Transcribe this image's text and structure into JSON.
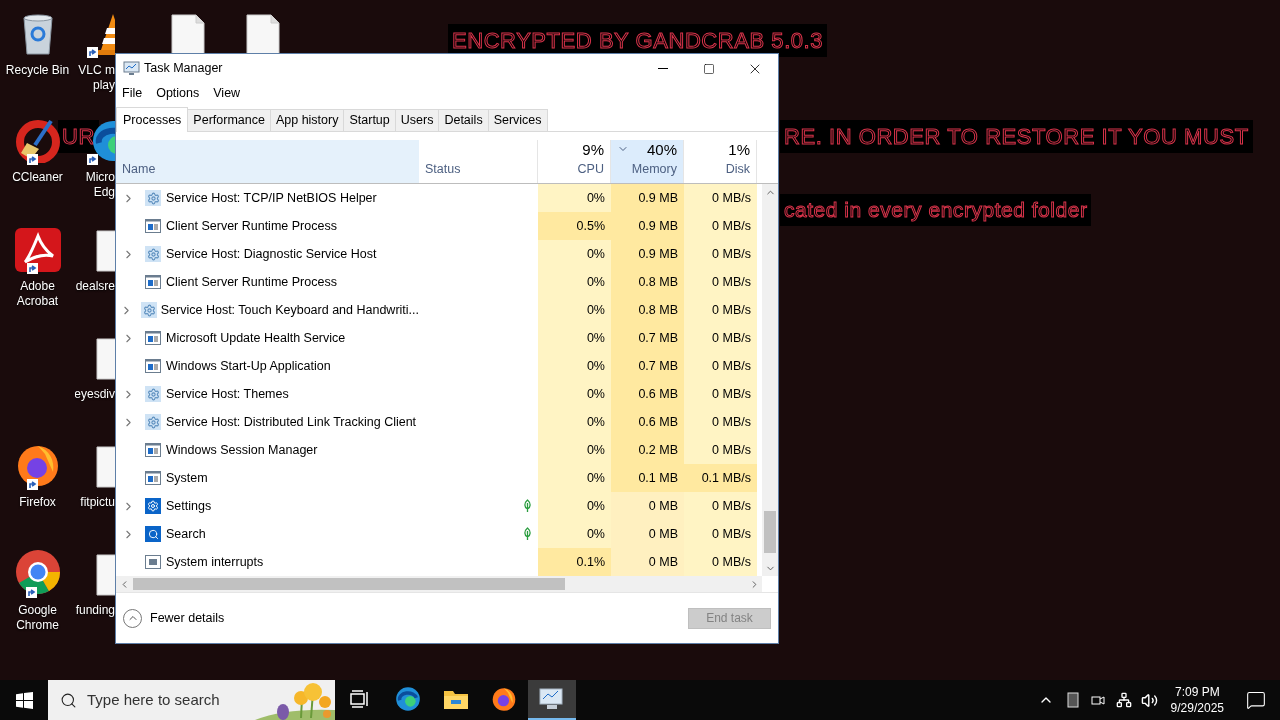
{
  "wallpaper_text": [
    {
      "text": "ENCRYPTED BY GANDCRAB 5.0.3"
    },
    {
      "text": "UR"
    },
    {
      "text": "RE. IN ORDER TO RESTORE IT YOU MUST"
    },
    {
      "text": "cated in every encrypted folder"
    }
  ],
  "desktop_icons": [
    {
      "kind": "recycle_bin",
      "label_lines": [
        "Recycle Bin"
      ],
      "shortcut": false
    },
    {
      "kind": "vlc",
      "label_lines": [
        "VLC m",
        "play"
      ],
      "shortcut": true
    },
    {
      "kind": "file",
      "shortcut": false
    },
    {
      "kind": "file",
      "shortcut": false
    },
    {
      "kind": "ccleaner",
      "label_lines": [
        "CCleaner"
      ],
      "shortcut": true
    },
    {
      "kind": "edge",
      "label_lines": [
        "Micro",
        "Edg"
      ],
      "shortcut": true
    },
    {
      "kind": "acrobat",
      "label_lines": [
        "Adobe",
        "Acrobat"
      ],
      "shortcut": true
    },
    {
      "kind": "file",
      "label_lines": [
        "dealsre"
      ],
      "shortcut": false
    },
    {
      "kind": "file",
      "label_lines": [
        "eyesdiv"
      ],
      "shortcut": false
    },
    {
      "kind": "firefox",
      "label_lines": [
        "Firefox"
      ],
      "shortcut": true
    },
    {
      "kind": "file",
      "label_lines": [
        "fitpictu"
      ],
      "shortcut": false
    },
    {
      "kind": "chrome",
      "label_lines": [
        "Google",
        "Chrome"
      ],
      "shortcut": true
    },
    {
      "kind": "file",
      "label_lines": [
        "funding"
      ],
      "shortcut": false
    }
  ],
  "window": {
    "title": "Task Manager",
    "menu": [
      "File",
      "Options",
      "View"
    ],
    "tabs": [
      {
        "label": "Processes",
        "selected": true
      },
      {
        "label": "Performance",
        "selected": false
      },
      {
        "label": "App history",
        "selected": false
      },
      {
        "label": "Startup",
        "selected": false
      },
      {
        "label": "Users",
        "selected": false
      },
      {
        "label": "Details",
        "selected": false
      },
      {
        "label": "Services",
        "selected": false
      }
    ],
    "columns": [
      {
        "kind": "name",
        "label": "Name",
        "highlighted": true
      },
      {
        "kind": "status",
        "label": "Status",
        "highlighted": false
      },
      {
        "kind": "metric",
        "percent": "9%",
        "label": "CPU",
        "highlighted": false,
        "sorted": false
      },
      {
        "kind": "metric",
        "percent": "40%",
        "label": "Memory",
        "highlighted": true,
        "sorted": true
      },
      {
        "kind": "metric",
        "percent": "1%",
        "label": "Disk",
        "highlighted": false,
        "sorted": false
      }
    ],
    "rows": [
      {
        "name": "Service Host: TCP/IP NetBIOS Helper",
        "kind": "gear",
        "expandable": true,
        "suspended": false,
        "cpu": {
          "text": "0%",
          "busy": false
        },
        "memory": {
          "text": "0.9 MB",
          "busy": true
        },
        "disk": {
          "text": "0 MB/s",
          "busy": false
        }
      },
      {
        "name": "Client Server Runtime Process",
        "kind": "window",
        "expandable": false,
        "suspended": false,
        "cpu": {
          "text": "0.5%",
          "busy": true
        },
        "memory": {
          "text": "0.9 MB",
          "busy": true
        },
        "disk": {
          "text": "0 MB/s",
          "busy": false
        }
      },
      {
        "name": "Service Host: Diagnostic Service Host",
        "kind": "gear",
        "expandable": true,
        "suspended": false,
        "cpu": {
          "text": "0%",
          "busy": false
        },
        "memory": {
          "text": "0.9 MB",
          "busy": true
        },
        "disk": {
          "text": "0 MB/s",
          "busy": false
        }
      },
      {
        "name": "Client Server Runtime Process",
        "kind": "window",
        "expandable": false,
        "suspended": false,
        "cpu": {
          "text": "0%",
          "busy": false
        },
        "memory": {
          "text": "0.8 MB",
          "busy": true
        },
        "disk": {
          "text": "0 MB/s",
          "busy": false
        }
      },
      {
        "name": "Service Host: Touch Keyboard and Handwriti...",
        "kind": "gear",
        "expandable": true,
        "suspended": false,
        "cpu": {
          "text": "0%",
          "busy": false
        },
        "memory": {
          "text": "0.8 MB",
          "busy": true
        },
        "disk": {
          "text": "0 MB/s",
          "busy": false
        }
      },
      {
        "name": "Microsoft Update Health Service",
        "kind": "window",
        "expandable": true,
        "suspended": false,
        "cpu": {
          "text": "0%",
          "busy": false
        },
        "memory": {
          "text": "0.7 MB",
          "busy": true
        },
        "disk": {
          "text": "0 MB/s",
          "busy": false
        }
      },
      {
        "name": "Windows Start-Up Application",
        "kind": "window",
        "expandable": false,
        "suspended": false,
        "cpu": {
          "text": "0%",
          "busy": false
        },
        "memory": {
          "text": "0.7 MB",
          "busy": true
        },
        "disk": {
          "text": "0 MB/s",
          "busy": false
        }
      },
      {
        "name": "Service Host: Themes",
        "kind": "gear",
        "expandable": true,
        "suspended": false,
        "cpu": {
          "text": "0%",
          "busy": false
        },
        "memory": {
          "text": "0.6 MB",
          "busy": true
        },
        "disk": {
          "text": "0 MB/s",
          "busy": false
        }
      },
      {
        "name": "Service Host: Distributed Link Tracking Client",
        "kind": "gear",
        "expandable": true,
        "suspended": false,
        "cpu": {
          "text": "0%",
          "busy": false
        },
        "memory": {
          "text": "0.6 MB",
          "busy": true
        },
        "disk": {
          "text": "0 MB/s",
          "busy": false
        }
      },
      {
        "name": "Windows Session Manager",
        "kind": "window",
        "expandable": false,
        "suspended": false,
        "cpu": {
          "text": "0%",
          "busy": false
        },
        "memory": {
          "text": "0.2 MB",
          "busy": true
        },
        "disk": {
          "text": "0 MB/s",
          "busy": false
        }
      },
      {
        "name": "System",
        "kind": "window",
        "expandable": false,
        "suspended": false,
        "cpu": {
          "text": "0%",
          "busy": false
        },
        "memory": {
          "text": "0.1 MB",
          "busy": true
        },
        "disk": {
          "text": "0.1 MB/s",
          "busy": true
        }
      },
      {
        "name": "Settings",
        "kind": "settings",
        "expandable": true,
        "suspended": true,
        "cpu": {
          "text": "0%",
          "busy": false
        },
        "memory": {
          "text": "0 MB",
          "busy": false
        },
        "disk": {
          "text": "0 MB/s",
          "busy": false
        }
      },
      {
        "name": "Search",
        "kind": "search",
        "expandable": true,
        "suspended": true,
        "cpu": {
          "text": "0%",
          "busy": false
        },
        "memory": {
          "text": "0 MB",
          "busy": false
        },
        "disk": {
          "text": "0 MB/s",
          "busy": false
        }
      },
      {
        "name": "System interrupts",
        "kind": "chip",
        "expandable": false,
        "suspended": false,
        "cpu": {
          "text": "0.1%",
          "busy": true
        },
        "memory": {
          "text": "0 MB",
          "busy": false
        },
        "disk": {
          "text": "0 MB/s",
          "busy": false
        }
      }
    ],
    "footer": {
      "toggle": "Fewer details",
      "end_task": {
        "label": "End task",
        "disabled": true
      }
    }
  },
  "taskbar": {
    "search_placeholder": "Type here to search",
    "apps": [
      {
        "kind": "task_view",
        "active": false
      },
      {
        "kind": "edge",
        "active": false
      },
      {
        "kind": "explorer",
        "active": false
      },
      {
        "kind": "firefox",
        "active": false
      },
      {
        "kind": "task_manager",
        "active": true
      }
    ],
    "time": "7:09 PM",
    "date": "9/29/2025"
  }
}
